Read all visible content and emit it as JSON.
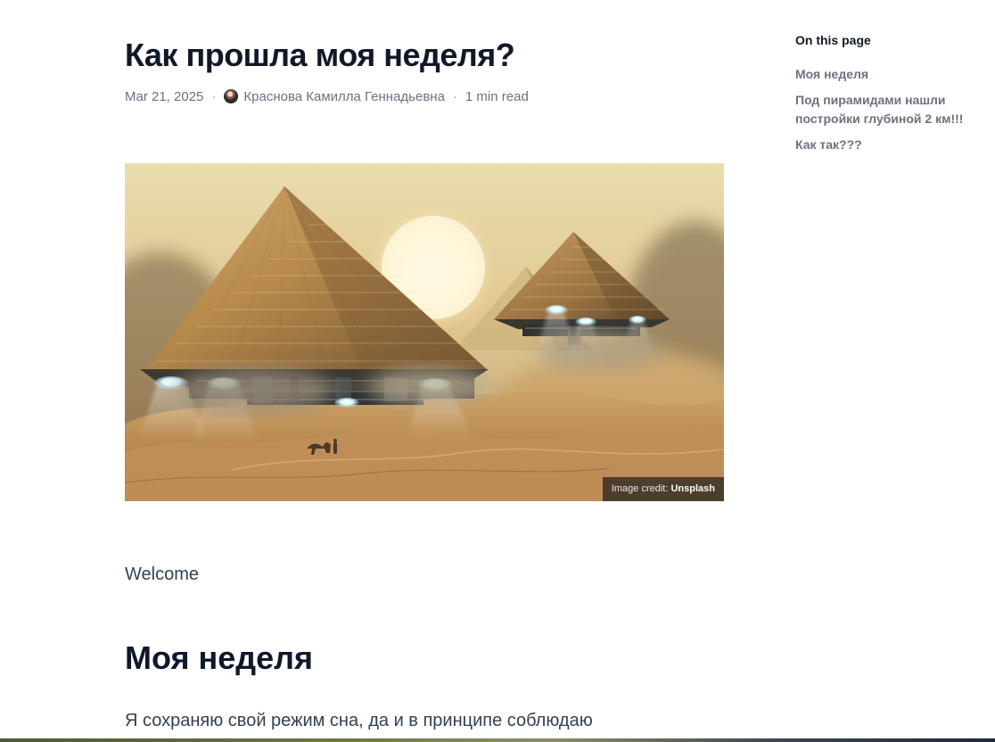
{
  "article": {
    "title": " Как прошла моя неделя?",
    "date": "Mar 21, 2025",
    "separator": "·",
    "author": "Краснова Камилла Геннадьевна",
    "read_time": "1 min read",
    "image": {
      "credit_prefix": "Image credit:",
      "credit_source": "Unsplash"
    },
    "welcome": "Welcome",
    "section_title": "Моя неделя",
    "paragraph_start": "Я сохраняю свой режим сна, да и в принципе соблюдаю"
  },
  "toc": {
    "title": "On this page",
    "items": [
      {
        "label": "Моя неделя"
      },
      {
        "label": "Под пирамидами нашли постройки глубиной 2 км!!!"
      },
      {
        "label": "Как так???"
      }
    ]
  },
  "colors": {
    "text_heading": "#111827",
    "text_muted": "#6b7280",
    "text_body": "#334155",
    "credit_overlay": "#171717",
    "desert_sand": "#c69a5c"
  },
  "icons": {
    "author_avatar": "avatar-icon"
  }
}
